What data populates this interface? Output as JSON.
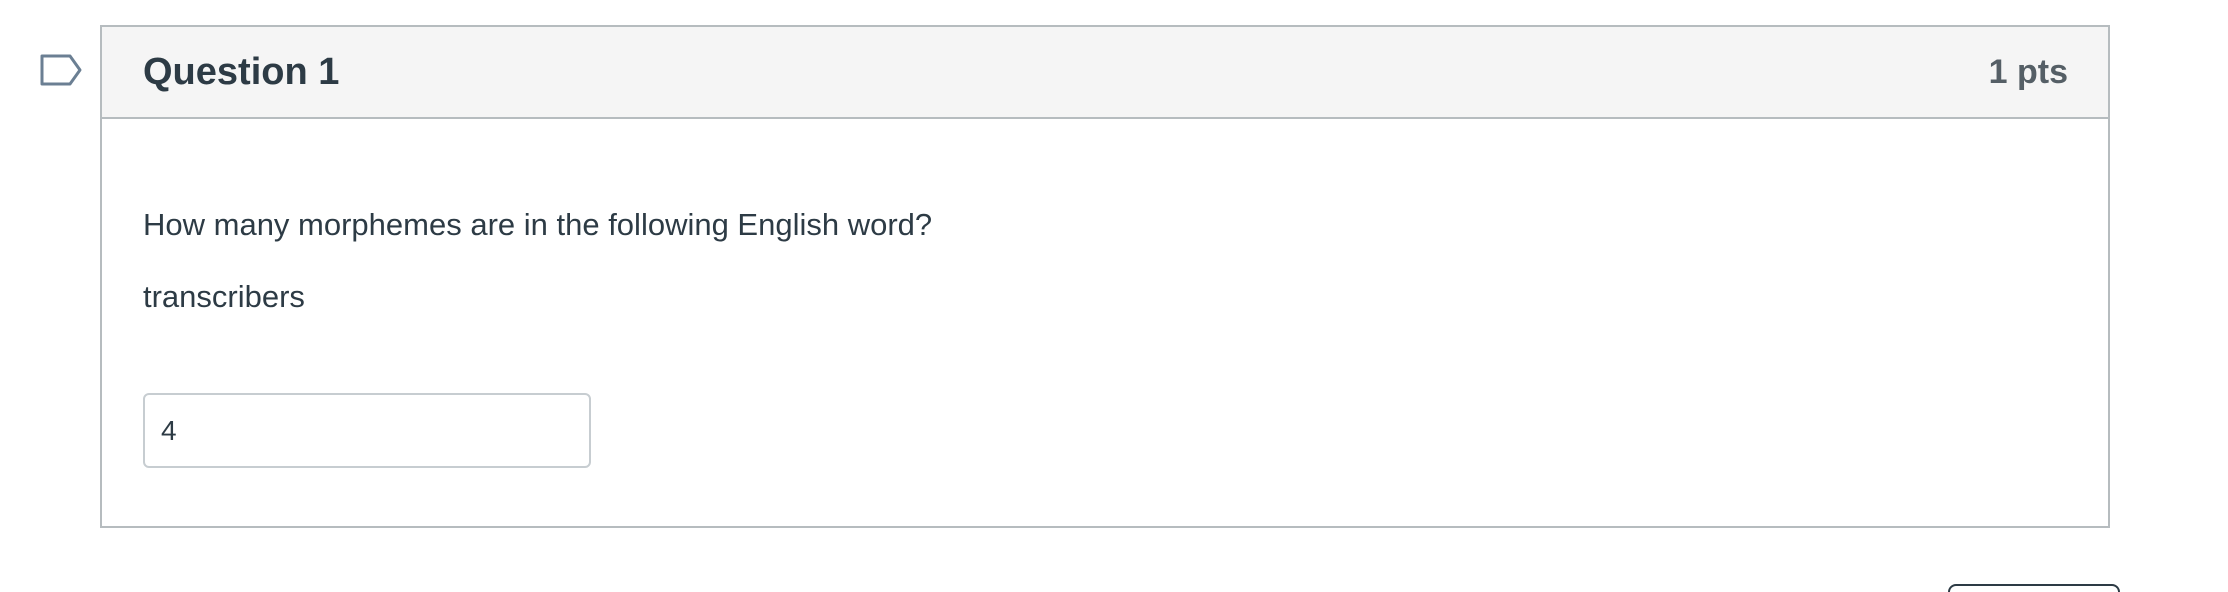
{
  "question": {
    "title": "Question 1",
    "points": "1 pts",
    "text": "How many morphemes are in the following English word?",
    "word": "transcribers",
    "answer_value": "4"
  },
  "icons": {
    "flag": "flag-question-icon"
  },
  "colors": {
    "header_bg": "#f5f5f5",
    "border": "#b6bcbf",
    "text": "#2d3b45",
    "points_text": "#555f66",
    "flag_stroke": "#6b7f93"
  }
}
